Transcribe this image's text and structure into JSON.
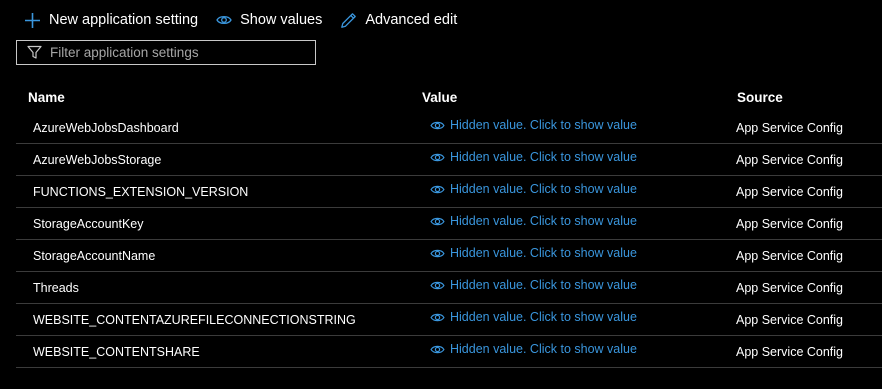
{
  "toolbar": {
    "new_setting_label": "New application setting",
    "show_values_label": "Show values",
    "advanced_edit_label": "Advanced edit",
    "accent_color": "#3a96dd"
  },
  "filter": {
    "placeholder": "Filter application settings",
    "value": ""
  },
  "table": {
    "headers": {
      "name": "Name",
      "value": "Value",
      "source": "Source"
    },
    "rows": [
      {
        "name": "AzureWebJobsDashboard",
        "value": "Hidden value. Click to show value",
        "source": "App Service Config"
      },
      {
        "name": "AzureWebJobsStorage",
        "value": "Hidden value. Click to show value",
        "source": "App Service Config"
      },
      {
        "name": "FUNCTIONS_EXTENSION_VERSION",
        "value": "Hidden value. Click to show value",
        "source": "App Service Config"
      },
      {
        "name": "StorageAccountKey",
        "value": "Hidden value. Click to show value",
        "source": "App Service Config"
      },
      {
        "name": "StorageAccountName",
        "value": "Hidden value. Click to show value",
        "source": "App Service Config"
      },
      {
        "name": "Threads",
        "value": "Hidden value. Click to show value",
        "source": "App Service Config"
      },
      {
        "name": "WEBSITE_CONTENTAZUREFILECONNECTIONSTRING",
        "value": "Hidden value. Click to show value",
        "source": "App Service Config"
      },
      {
        "name": "WEBSITE_CONTENTSHARE",
        "value": "Hidden value. Click to show value",
        "source": "App Service Config"
      }
    ]
  },
  "icons": {
    "new_setting": "plus-icon",
    "show_values": "eye-icon",
    "advanced_edit": "pencil-icon",
    "filter": "funnel-icon",
    "row_value": "eye-icon"
  }
}
